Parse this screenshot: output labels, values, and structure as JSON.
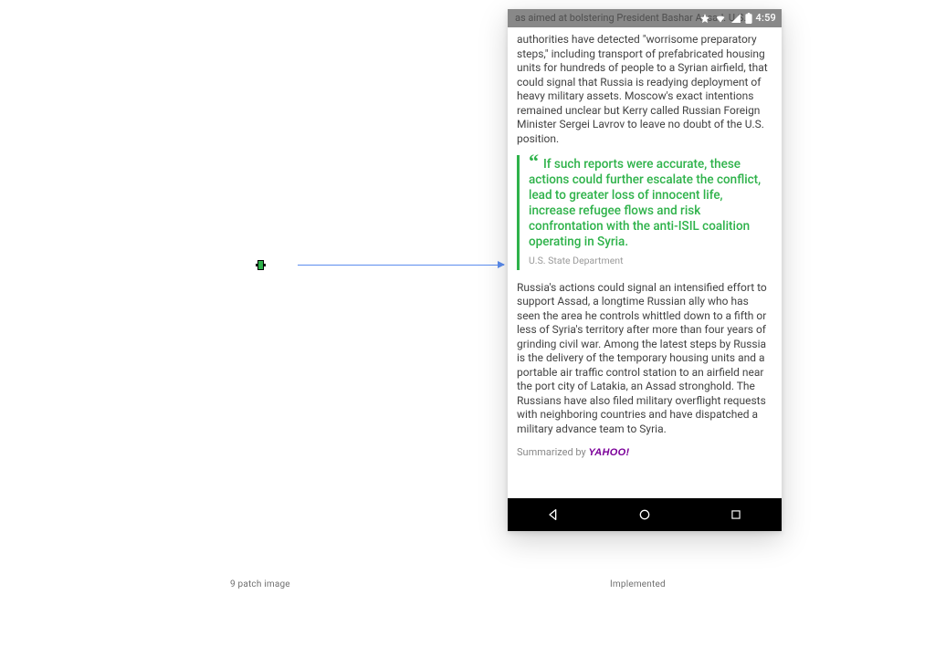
{
  "asset_label": "9 patch image",
  "implemented_label": "Implemented",
  "device": {
    "status_bar": {
      "bg_text": "as aimed at bolstering President Bashar Assad. U.S.",
      "time": "4:59"
    },
    "article": {
      "para_top": "authorities have detected \"worrisome preparatory steps,\" including transport of prefabricated housing units for hundreds of people to a Syrian airfield, that could signal that Russia is readying deployment of heavy military assets. Moscow's exact intentions remained unclear but Kerry called Russian Foreign Minister Sergei Lavrov to leave no doubt of the U.S. position.",
      "quote": {
        "text": "If such reports were accurate, these actions could further escalate the conflict, lead to greater loss of innocent life, increase refugee flows and risk confrontation with the anti-ISIL coalition operating in Syria.",
        "attribution": "U.S. State Department"
      },
      "para_bottom": "Russia's actions could signal an intensified effort to support Assad, a longtime Russian ally who has seen the area he controls whittled down to a fifth or less of Syria's territory after more than four years of grinding civil war. Among the latest steps by Russia is the delivery of the temporary housing units and a portable air traffic control station to an airfield near the port city of Latakia, an Assad stronghold. The Russians have also filed military overflight requests with neighboring countries and have dispatched a military advance team to Syria.",
      "summarized_by_prefix": "Summarized by ",
      "summarized_by_brand": "YAHOO",
      "summarized_by_bang": "!"
    }
  },
  "colors": {
    "accent_green": "#2eb24a",
    "arrow_blue": "#5b8def",
    "brand_purple": "#7b0099"
  }
}
